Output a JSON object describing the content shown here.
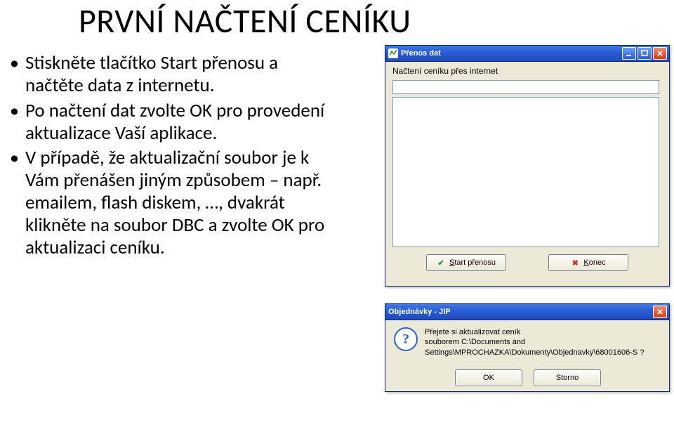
{
  "heading": "PRVNÍ NAČTENÍ CENÍKU",
  "bullets": {
    "i0": "Stiskněte tlačítko Start přenosu a načtěte data z internetu.",
    "i1": "Po načtení dat zvolte OK pro provedení aktualizace Vaší aplikace.",
    "i2": "V případě, že aktualizační soubor je k Vám přenášen jiným způsobem – např. emailem, flash diskem, …, dvakrát klikněte na soubor DBC a zvolte OK pro aktualizaci ceníku."
  },
  "dlg_transfer": {
    "title": "Přenos dat",
    "label": "Načtení ceníku přes internet",
    "btn_start_prefix": "S",
    "btn_start_rest": "tart přenosu",
    "btn_end_prefix": "K",
    "btn_end_rest": "onec"
  },
  "dlg_confirm": {
    "title": "Objednávky - JIP",
    "msg_line1": "Přejete si aktualizovat ceník",
    "msg_line2": "souborem C:\\Documents and Settings\\MPROCHAZKA\\Dokumenty\\Objednavky\\68001606-S ?",
    "btn_ok": "OK",
    "btn_cancel": "Storno"
  }
}
